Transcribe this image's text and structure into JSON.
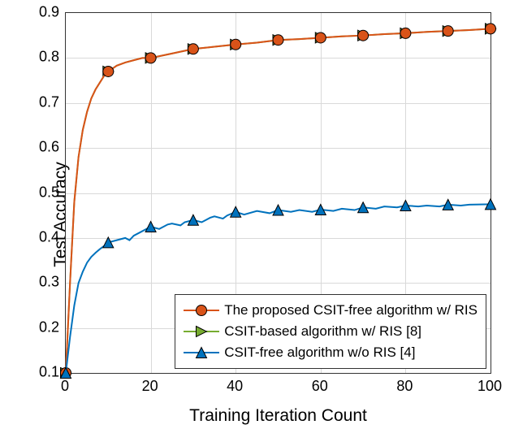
{
  "chart_data": {
    "type": "line",
    "xlabel": "Training Iteration Count",
    "ylabel": "Test Accuracy",
    "xlim": [
      0,
      100
    ],
    "ylim": [
      0.1,
      0.9
    ],
    "xticks": [
      0,
      20,
      40,
      60,
      80,
      100
    ],
    "yticks": [
      0.1,
      0.2,
      0.3,
      0.4,
      0.5,
      0.6,
      0.7,
      0.8,
      0.9
    ],
    "legend_position": "bottom-right-inside",
    "series": [
      {
        "name": "The proposed CSIT-free algorithm w/ RIS",
        "color": "#d95319",
        "marker_fill": "#d95319",
        "marker_edge": "#000000",
        "marker": "circle",
        "x": [
          0,
          1,
          2,
          3,
          4,
          5,
          6,
          7,
          8,
          9,
          10,
          12,
          14,
          16,
          18,
          20,
          25,
          30,
          35,
          40,
          45,
          50,
          55,
          60,
          65,
          70,
          75,
          80,
          85,
          90,
          95,
          100
        ],
        "y": [
          0.1,
          0.3,
          0.48,
          0.58,
          0.64,
          0.68,
          0.71,
          0.73,
          0.745,
          0.76,
          0.77,
          0.783,
          0.79,
          0.795,
          0.8,
          0.8,
          0.81,
          0.82,
          0.825,
          0.83,
          0.834,
          0.84,
          0.842,
          0.845,
          0.848,
          0.85,
          0.853,
          0.855,
          0.858,
          0.86,
          0.862,
          0.865
        ],
        "marker_x": [
          0,
          10,
          20,
          30,
          40,
          50,
          60,
          70,
          80,
          90,
          100
        ],
        "marker_y": [
          0.1,
          0.77,
          0.8,
          0.82,
          0.83,
          0.84,
          0.845,
          0.85,
          0.855,
          0.86,
          0.865
        ]
      },
      {
        "name": "CSIT-based algorithm w/ RIS [8]",
        "color": "#77ac30",
        "marker_fill": "#77ac30",
        "marker_edge": "#000000",
        "marker": "triangle-right",
        "x": [
          0,
          1,
          2,
          3,
          4,
          5,
          6,
          7,
          8,
          9,
          10,
          12,
          14,
          16,
          18,
          20,
          25,
          30,
          35,
          40,
          45,
          50,
          55,
          60,
          65,
          70,
          75,
          80,
          85,
          90,
          95,
          100
        ],
        "y": [
          0.1,
          0.3,
          0.48,
          0.58,
          0.64,
          0.68,
          0.71,
          0.73,
          0.745,
          0.76,
          0.77,
          0.783,
          0.79,
          0.795,
          0.8,
          0.8,
          0.81,
          0.82,
          0.825,
          0.83,
          0.834,
          0.84,
          0.842,
          0.845,
          0.848,
          0.85,
          0.853,
          0.855,
          0.858,
          0.86,
          0.862,
          0.865
        ],
        "marker_x": [
          0,
          10,
          20,
          30,
          40,
          50,
          60,
          70,
          80,
          90,
          100
        ],
        "marker_y": [
          0.1,
          0.77,
          0.8,
          0.82,
          0.83,
          0.84,
          0.845,
          0.85,
          0.855,
          0.86,
          0.865
        ]
      },
      {
        "name": "CSIT-free algorithm w/o RIS [4]",
        "color": "#0072bd",
        "marker_fill": "#0072bd",
        "marker_edge": "#000000",
        "marker": "triangle-up",
        "x": [
          0,
          1,
          2,
          3,
          4,
          5,
          6,
          7,
          8,
          9,
          10,
          12,
          14,
          15,
          16,
          18,
          20,
          22,
          24,
          25,
          27,
          28,
          30,
          32,
          34,
          35,
          37,
          38,
          40,
          42,
          45,
          48,
          50,
          53,
          55,
          58,
          60,
          63,
          65,
          68,
          70,
          73,
          75,
          78,
          80,
          83,
          85,
          88,
          90,
          93,
          95,
          100
        ],
        "y": [
          0.1,
          0.18,
          0.25,
          0.3,
          0.325,
          0.345,
          0.358,
          0.367,
          0.375,
          0.382,
          0.39,
          0.395,
          0.4,
          0.395,
          0.405,
          0.415,
          0.425,
          0.42,
          0.43,
          0.432,
          0.428,
          0.435,
          0.44,
          0.435,
          0.445,
          0.448,
          0.443,
          0.45,
          0.458,
          0.452,
          0.46,
          0.455,
          0.462,
          0.458,
          0.462,
          0.458,
          0.463,
          0.46,
          0.465,
          0.462,
          0.468,
          0.465,
          0.47,
          0.468,
          0.472,
          0.47,
          0.472,
          0.47,
          0.474,
          0.472,
          0.474,
          0.475
        ],
        "marker_x": [
          0,
          10,
          20,
          30,
          40,
          50,
          60,
          70,
          80,
          90,
          100
        ],
        "marker_y": [
          0.1,
          0.39,
          0.425,
          0.44,
          0.458,
          0.462,
          0.463,
          0.468,
          0.472,
          0.474,
          0.475
        ]
      }
    ]
  }
}
